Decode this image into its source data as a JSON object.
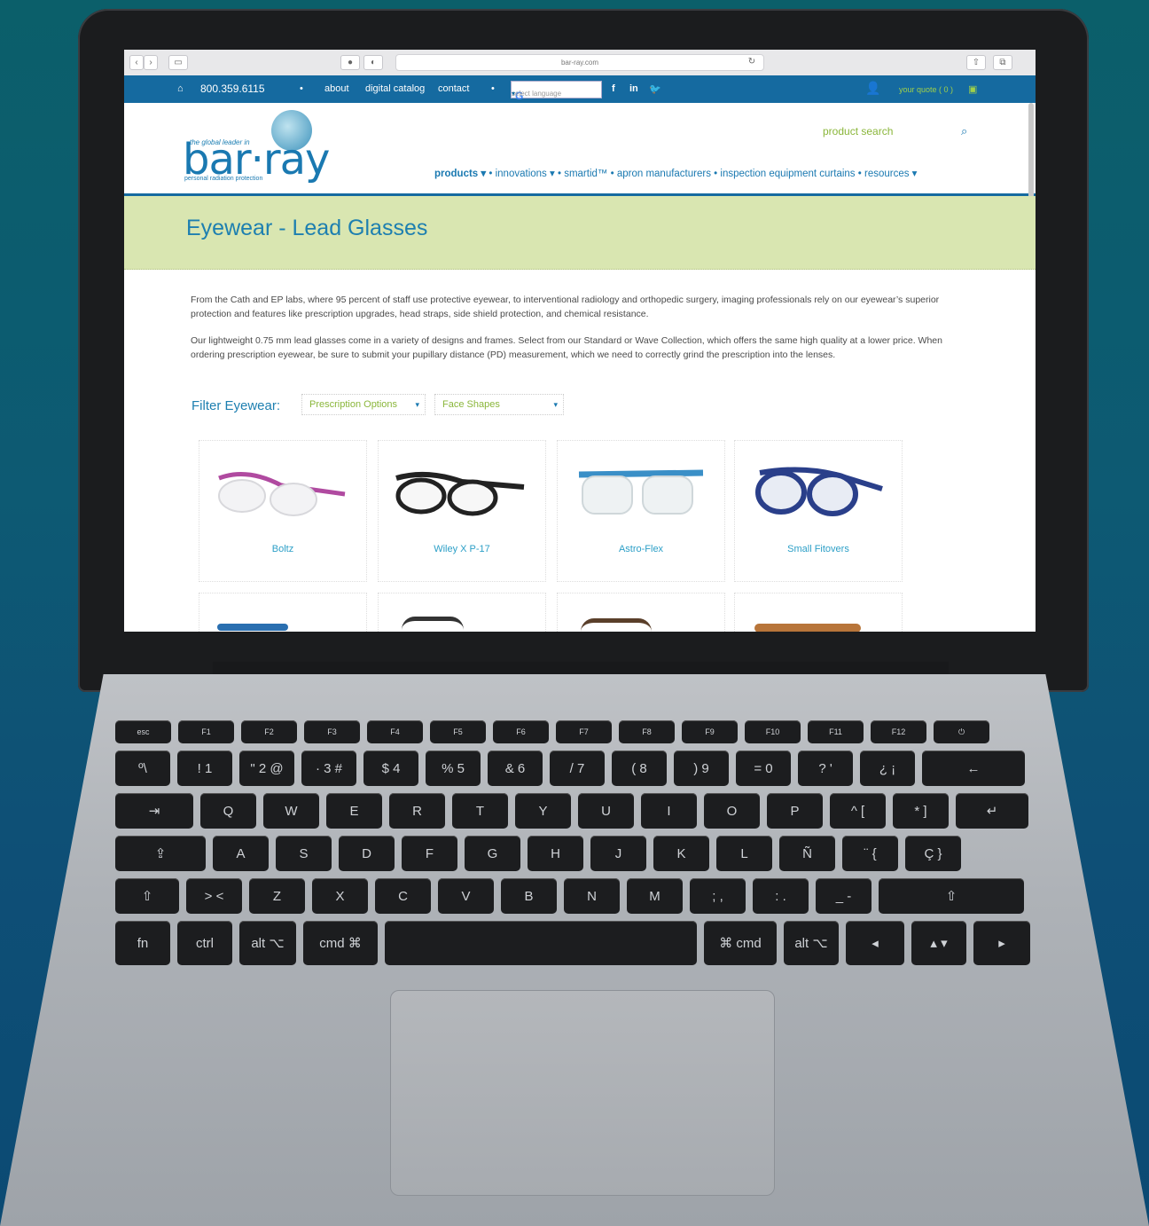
{
  "browser": {
    "url": "bar-ray.com"
  },
  "topbar": {
    "phone": "800.359.6115",
    "links": [
      "about",
      "digital catalog",
      "contact"
    ],
    "language_placeholder": "select language",
    "social": [
      "f",
      "in",
      "✓"
    ],
    "quote": "your quote ( 0 )"
  },
  "logo": {
    "tagline_top": "the global leader in",
    "name": "bar·ray",
    "tagline_bottom": "personal radiation protection"
  },
  "search": {
    "placeholder": "product search"
  },
  "menu": {
    "items": [
      "products ▾",
      "innovations ▾",
      "smartid™",
      "apron manufacturers",
      "inspection equipment curtains",
      "resources ▾"
    ]
  },
  "page": {
    "title": "Eyewear - Lead Glasses",
    "para1": "From the Cath and EP labs, where 95 percent of staff use protective eyewear, to interventional radiology and orthopedic surgery, imaging professionals rely on our eyewear’s superior protection and features like prescription upgrades, head straps, side shield protection, and chemical resistance.",
    "para2": "Our lightweight 0.75 mm lead glasses come in a variety of designs and frames. Select from our Standard or Wave Collection, which offers the same high quality at a lower price. When ordering prescription eyewear, be sure to submit your pupillary distance (PD) measurement, which we need to correctly grind the prescription into the lenses.",
    "filter_label": "Filter Eyewear:",
    "filter1": "Prescription Options",
    "filter2": "Face Shapes"
  },
  "products": [
    {
      "name": "Boltz",
      "color": "#b04aa0"
    },
    {
      "name": "Wiley X P-17",
      "color": "#222222"
    },
    {
      "name": "Astro-Flex",
      "color": "#3a8fc7"
    },
    {
      "name": "Small Fitovers",
      "color": "#2a3f8a"
    }
  ],
  "keyboard": {
    "fn_row": [
      "esc",
      "F1",
      "F2",
      "F3",
      "F4",
      "F5",
      "F6",
      "F7",
      "F8",
      "F9",
      "F10",
      "F11",
      "F12",
      "⏻"
    ],
    "row1": [
      "º\\",
      "! 1",
      "\" 2 @",
      "· 3 #",
      "$ 4",
      "% 5",
      "& 6",
      "/ 7",
      "( 8",
      ") 9",
      "= 0",
      "? '",
      "¿ ¡",
      "←"
    ],
    "row2": [
      "⇥",
      "Q",
      "W",
      "E",
      "R",
      "T",
      "Y",
      "U",
      "I",
      "O",
      "P",
      "^ [",
      "* ]",
      "↵"
    ],
    "row3": [
      "⇪",
      "A",
      "S",
      "D",
      "F",
      "G",
      "H",
      "J",
      "K",
      "L",
      "Ñ",
      "¨ {",
      "Ç }"
    ],
    "row4": [
      "⇧",
      "> <",
      "Z",
      "X",
      "C",
      "V",
      "B",
      "N",
      "M",
      "; ,",
      ": .",
      "_ -",
      "⇧"
    ],
    "row5": [
      "fn",
      "ctrl",
      "alt ⌥",
      "cmd ⌘",
      "",
      "⌘ cmd",
      "alt ⌥",
      "◂",
      "▴ ▾",
      "▸"
    ]
  }
}
